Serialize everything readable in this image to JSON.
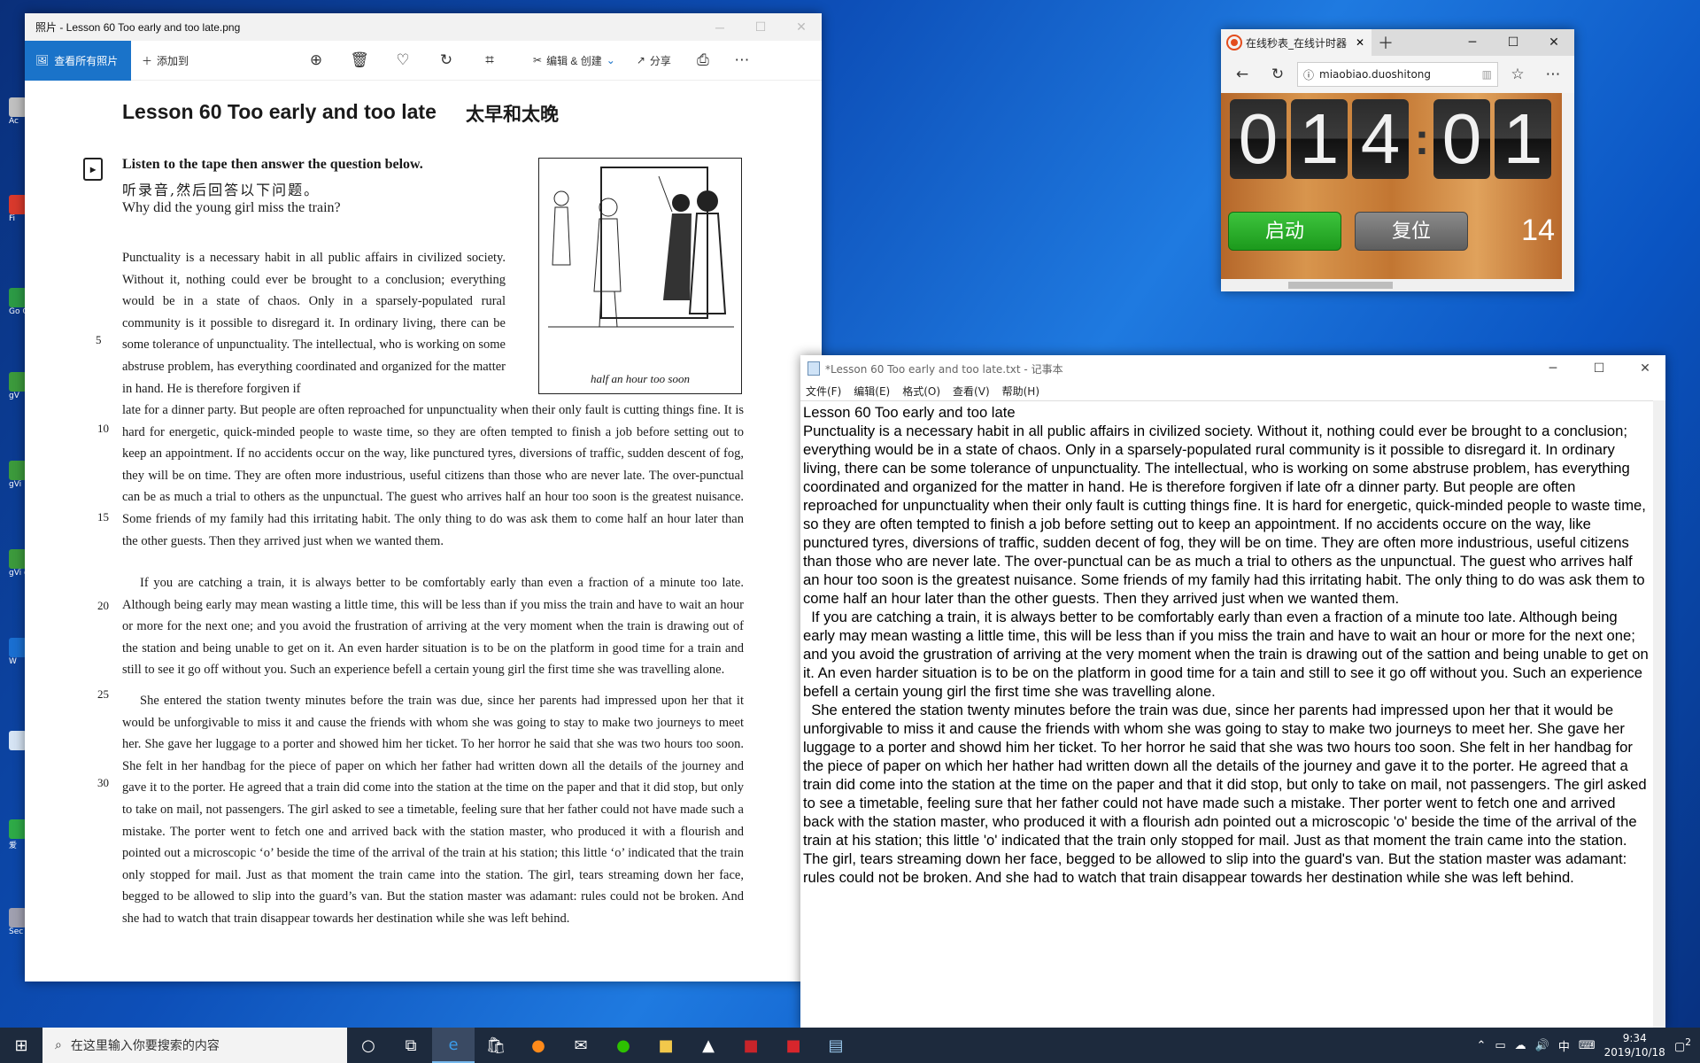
{
  "desktop": {
    "icons": [
      {
        "label": "Ac",
        "color": "#c0c0c0"
      },
      {
        "label": "Fi",
        "color": "#d9392c"
      },
      {
        "label": "Go Ch",
        "color": "#2c9a45"
      },
      {
        "label": "gV",
        "color": "#3c9a3c"
      },
      {
        "label": "gVi",
        "color": "#3c9a3c"
      },
      {
        "label": "gVi on",
        "color": "#3c9a3c"
      },
      {
        "label": "W",
        "color": "#1a6fd1"
      },
      {
        "label": "",
        "color": "#d6e4f4"
      },
      {
        "label": "爱",
        "color": "#2eaa47"
      },
      {
        "label": "Sec",
        "color": "#a0a0b0"
      }
    ]
  },
  "photos": {
    "title": "照片 - Lesson 60 Too early and too late.png",
    "toolbar": {
      "view_all": "查看所有照片",
      "add_to": "添加到",
      "edit_create": "编辑 & 创建",
      "share": "分享"
    },
    "scan": {
      "lesson_title": "Lesson 60   Too early and too late",
      "lesson_cn": "太早和太晚",
      "q_en": "Listen to the tape then answer the question below.",
      "q_cn": "听录音,然后回答以下问题。",
      "q_question": "Why did the young girl miss the train?",
      "illus_caption": "half an hour too soon",
      "p1a": "Punctuality is a necessary habit in all public affairs in civilized society. Without it, nothing could ever be brought to a conclusion; everything would be in a state of chaos. Only in a sparsely-populated rural community is it possible to disregard it. In ordinary living, there can be some tolerance of unpunctuality. The intellectual, who is working on some abstruse problem, has everything coordinated and organized for the matter in hand. He is therefore forgiven if",
      "p1b": "late for a dinner party. But people are often reproached for unpunctuality when their only fault is cutting things fine. It is hard for energetic, quick-minded people to waste time, so they are often tempted to finish a job before setting out to keep an appointment. If no accidents occur on the way, like punctured tyres, diversions of traffic, sudden descent of fog, they will be on time. They are often more industrious, useful citizens than those who are never late. The over-punctual can be as much a trial to others as the unpunctual. The guest who arrives half an hour too soon is the greatest nuisance. Some friends of my family had this irritating habit. The only thing to do was ask them to come half an hour later than the other guests. Then they arrived just when we wanted them.",
      "p2": "If you are catching a train, it is always better to be comfortably early than even a fraction of a minute too late. Although being early may mean wasting a little time, this will be less than if you miss the train and have to wait an hour or more for the next one; and you avoid the frustration of arriving at the very moment when the train is drawing out of the station and being unable to get on it. An even harder situation is to be on the platform in good time for a train and still to see it go off without you. Such an experience befell a certain young girl the first time she was travelling alone.",
      "p3": "She entered the station twenty minutes before the train was due, since her parents had impressed upon her that it would be unforgivable to miss it and cause the friends with whom she was going to stay to make two journeys to meet her. She gave her luggage to a porter and showed him her ticket. To her horror he said that she was two hours too soon. She felt in her handbag for the piece of paper on which her father had written down all the details of the journey and gave it to the porter. He agreed that a train did come into the station at the time on the paper and that it did stop, but only to take on mail, not passengers. The girl asked to see a timetable, feeling sure that her father could not have made such a mistake. The porter went to fetch one and arrived back with the station master, who produced it with a flourish and pointed out a microscopic ‘o’ beside the time of the arrival of the train at his station; this little ‘o’ indicated that the train only stopped for mail. Just as that moment the train came into the station. The girl, tears streaming down her face, begged to be allowed to slip into the guard’s van. But the station master was adamant: rules could not be broken. And she had to watch that train disappear towards her destination while she was left behind.",
      "line_numbers": [
        "5",
        "10",
        "15",
        "20",
        "25",
        "30"
      ]
    }
  },
  "edge": {
    "tab_title": "在线秒表_在线计时器",
    "url": "miaobiao.duoshitong",
    "timer": {
      "digits": [
        "0",
        "1",
        "4",
        "0",
        "1"
      ],
      "separator": ":",
      "start": "启动",
      "reset": "复位",
      "counter": "14"
    }
  },
  "notepad": {
    "title": "*Lesson 60 Too early and too late.txt - 记事本",
    "menu": [
      "文件(F)",
      "编辑(E)",
      "格式(O)",
      "查看(V)",
      "帮助(H)"
    ],
    "text": "Lesson 60 Too early and too late\nPunctuality is a necessary habit in all public affairs in civilized society. Without it, nothing could ever be brought to a conclusion; everything would be in a state of chaos. Only in a sparsely-populated rural community is it possible to disregard it. In ordinary living, there can be some tolerance of unpunctuality. The intellectual, who is working on some abstruse problem, has everything coordinated and organized for the matter in hand. He is therefore forgiven if late ofr a dinner party. But people are often reproached for unpunctuality when their only fault is cutting things fine. It is hard for energetic, quick-minded people to waste time, so they are often tempted to finish a job before setting out to keep an appointment. If no accidents occure on the way, like punctured tyres, diversions of traffic, sudden decent of fog, they will be on time. They are often more industrious, useful citizens than those who are never late. The over-punctual can be as much a trial to others as the unpunctual. The guest who arrives half an hour too soon is the greatest nuisance. Some friends of my family had this irritating habit. The only thing to do was ask them to come half an hour later than the other guests. Then they arrived just when we wanted them.\n  If you are catching a train, it is always better to be comfortably early than even a fraction of a minute too late. Although being early may mean wasting a little time, this will be less than if you miss the train and have to wait an hour or more for the next one; and you avoid the grustration of arriving at the very moment when the train is drawing out of the sattion and being unable to get on it. An even harder situation is to be on the platform in good time for a tain and still to see it go off without you. Such an experience befell a certain young girl the first time she was travelling alone.\n  She entered the station twenty minutes before the train was due, since her parents had impressed upon her that it would be unforgivable to miss it and cause the friends with whom she was going to stay to make two journeys to meet her. She gave her luggage to a porter and showd him her ticket. To her horror he said that she was two hours too soon. She felt in her handbag for the piece of paper on which her hather had written down all the details of the journey and gave it to the porter. He agreed that a train did come into the station at the time on the paper and that it did stop, but only to take on mail, not passengers. The girl asked to see a timetable, feeling sure that her father could not have made such a mistake. Ther porter went to fetch one and arrived back with the station master, who produced it with a flourish adn pointed out a microscopic 'o' beside the time of the arrival of the train at his station; this little 'o' indicated that the train only stopped for mail. Just as that moment the train came into the station. The girl, tears streaming down her face, begged to be allowed to slip into the guard's van. But the station master was adamant: rules could not be broken. And she had to watch that train disappear towards her destination while she was left behind."
  },
  "taskbar": {
    "search_placeholder": "在这里输入你要搜索的内容",
    "time": "9:34",
    "date": "2019/10/18",
    "ime": "中",
    "notification_count": "2"
  }
}
